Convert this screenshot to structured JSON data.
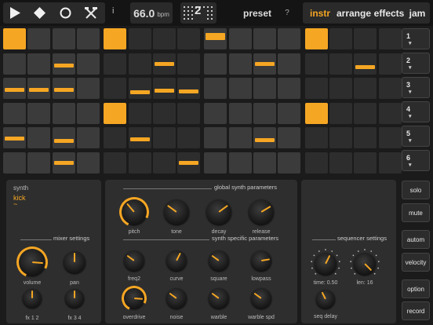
{
  "topbar": {
    "info_label": "i",
    "bpm_value": "66.0",
    "bpm_unit": "bpm",
    "pattern_number": "2",
    "preset_label": "preset",
    "help_label": "?",
    "tabs": [
      "instr",
      "arrange",
      "effects",
      "jam"
    ],
    "active_tab": "instr"
  },
  "colors": {
    "accent": "#f5a623",
    "cell": "#3b3b3b",
    "cell_dim": "#2d2d2d",
    "panel": "#2e2e2e"
  },
  "sequencer": {
    "rows": 6,
    "cols": 16,
    "notes": [
      {
        "row": 0,
        "col": 0,
        "level": 1.0
      },
      {
        "row": 0,
        "col": 4,
        "level": 1.0
      },
      {
        "row": 0,
        "col": 8,
        "level": 0.7
      },
      {
        "row": 0,
        "col": 12,
        "level": 1.0
      },
      {
        "row": 1,
        "col": 2,
        "level": 0.35
      },
      {
        "row": 1,
        "col": 6,
        "level": 0.45
      },
      {
        "row": 1,
        "col": 10,
        "level": 0.45
      },
      {
        "row": 1,
        "col": 14,
        "level": 0.25
      },
      {
        "row": 2,
        "col": 0,
        "level": 0.35
      },
      {
        "row": 2,
        "col": 1,
        "level": 0.35
      },
      {
        "row": 2,
        "col": 2,
        "level": 0.35
      },
      {
        "row": 2,
        "col": 5,
        "level": 0.2
      },
      {
        "row": 2,
        "col": 6,
        "level": 0.3
      },
      {
        "row": 2,
        "col": 7,
        "level": 0.25
      },
      {
        "row": 3,
        "col": 4,
        "level": 1.0
      },
      {
        "row": 3,
        "col": 12,
        "level": 1.0
      },
      {
        "row": 4,
        "col": 0,
        "level": 0.4
      },
      {
        "row": 4,
        "col": 2,
        "level": 0.25
      },
      {
        "row": 4,
        "col": 5,
        "level": 0.35
      },
      {
        "row": 4,
        "col": 10,
        "level": 0.3
      },
      {
        "row": 5,
        "col": 2,
        "level": 0.45
      },
      {
        "row": 5,
        "col": 7,
        "level": 0.45
      }
    ]
  },
  "tracks": [
    "1",
    "2",
    "3",
    "4",
    "5",
    "6"
  ],
  "side_buttons": [
    "solo",
    "mute",
    "autom",
    "velocity",
    "option",
    "record"
  ],
  "synth": {
    "label": "synth",
    "name": "kick",
    "toggle": "~"
  },
  "mixer": {
    "title": "mixer settings",
    "knobs": [
      {
        "label": "volume",
        "value": 0.85,
        "ring": true
      },
      {
        "label": "pan",
        "value": 0.5,
        "ring": false
      },
      {
        "label": "fx 1 2",
        "value": 0.5,
        "ring": false
      },
      {
        "label": "fx 3 4",
        "value": 0.5,
        "ring": false
      }
    ]
  },
  "global": {
    "title": "global synth parameters",
    "knobs": [
      {
        "label": "pitch",
        "value": 0.35,
        "ring": true
      },
      {
        "label": "tone",
        "value": 0.3,
        "ring": false
      },
      {
        "label": "decay",
        "value": 0.7,
        "ring": false
      },
      {
        "label": "release",
        "value": 0.72,
        "ring": false
      }
    ]
  },
  "specific": {
    "title": "synth specific parameters",
    "knobs": [
      {
        "label": "freq2",
        "value": 0.3,
        "ring": false
      },
      {
        "label": "curve",
        "value": 0.6,
        "ring": false
      },
      {
        "label": "square",
        "value": 0.3,
        "ring": false
      },
      {
        "label": "lowpass",
        "value": 0.8,
        "ring": false
      },
      {
        "label": "overdrive",
        "value": 0.85,
        "ring": true
      },
      {
        "label": "noise",
        "value": 0.3,
        "ring": false
      },
      {
        "label": "warble",
        "value": 0.3,
        "ring": false
      },
      {
        "label": "warble spd",
        "value": 0.3,
        "ring": false
      }
    ]
  },
  "seq_settings": {
    "title": "sequencer settings",
    "knobs": [
      {
        "label": "time: 0.50",
        "value": 0.6,
        "ring": false,
        "ticks": true
      },
      {
        "label": "len: 16",
        "value": 1.0,
        "ring": false,
        "ticks": true
      },
      {
        "label": "seq delay",
        "value": 0.4,
        "ring": false,
        "ticks": false
      }
    ]
  }
}
